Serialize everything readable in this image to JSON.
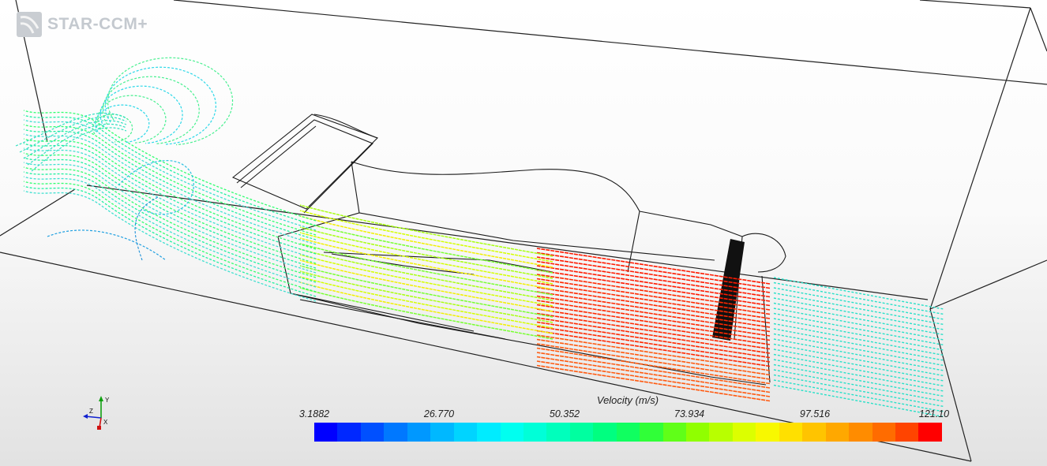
{
  "app": {
    "logo_text": "STAR-CCM+",
    "logo_icon": "star-ccm-logo-icon"
  },
  "legend": {
    "title": "Velocity (m/s)",
    "ticks": [
      "3.1882",
      "26.770",
      "50.352",
      "73.934",
      "97.516",
      "121.10"
    ],
    "min": 3.1882,
    "max": 121.1,
    "colors": [
      "#0000ff",
      "#0028ff",
      "#0050ff",
      "#0078ff",
      "#0098ff",
      "#00b8ff",
      "#00d4ff",
      "#00ecff",
      "#00fff0",
      "#00ffd8",
      "#00ffbc",
      "#00ffa0",
      "#00ff80",
      "#10ff60",
      "#30ff38",
      "#60ff18",
      "#90ff00",
      "#b8ff00",
      "#dcff00",
      "#f8f800",
      "#ffe000",
      "#ffc400",
      "#ffa800",
      "#ff8c00",
      "#ff6c00",
      "#ff4400",
      "#ff0000"
    ]
  },
  "axes_triad": {
    "labels": [
      "Y",
      "Z",
      "X"
    ],
    "icon": "axes-triad-icon"
  },
  "scene": {
    "description_icons": [
      "streamline-plot",
      "car-body-outline",
      "domain-box-wireframe"
    ]
  }
}
